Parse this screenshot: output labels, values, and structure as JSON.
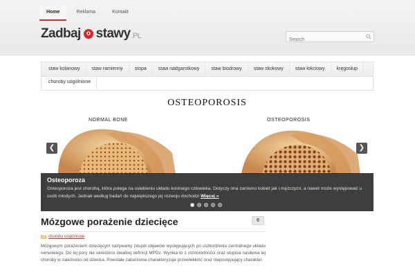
{
  "topnav": [
    {
      "label": "Home",
      "active": true
    },
    {
      "label": "Reklama",
      "active": false
    },
    {
      "label": "Kontakt",
      "active": false
    }
  ],
  "logo": {
    "part1": "Zadbaj",
    "o": "o",
    "part2": "stawy",
    "tld": ".PL"
  },
  "search": {
    "placeholder": "Search"
  },
  "categories": [
    "staw kolanowy",
    "staw ramienny",
    "stopa",
    "staw nadgarstkowy",
    "staw biodrowy",
    "staw skokowy",
    "staw łokciowy",
    "kręgosłup",
    "choroby uogólnione"
  ],
  "slider": {
    "image_title": "OSTEOPOROSIS",
    "label_left": "NORMAL BONE",
    "label_right": "OSTEOPOROSIS",
    "caption_title": "Osteoporoza",
    "caption_text": "Osteoporoza jest chorobą, która polega na osłabieniu układu kostnego człowieka. Dotyczy ona zarówno kobiet jak i mężczyzn, a nawet może występować u osób młodych. Jednak według badań do największego jej rozwoju dochodzi",
    "more_label": "Więcej »",
    "slide_count": 5,
    "active_slide": 1
  },
  "post": {
    "title": "Mózgowe porażenie dziecięce",
    "comments": "0",
    "category": "choroby uogólnione",
    "excerpt": "Mózgowym porażeniem dziecięcym nazywamy zespół objawów występujących po uszkodzeniu centralnego układu nerwowego. Do tej pory nie określono idealnej definicji MPDz. Wynika to z różnorodności oraz stopnia nasilenia tej choroby w zależności od dziecka. Powstałe zaburzenia charakteryzuje przewlekłość oraz niepostępujący charakter."
  },
  "colors": {
    "accent": "#d9262b",
    "link": "#c0392b"
  }
}
